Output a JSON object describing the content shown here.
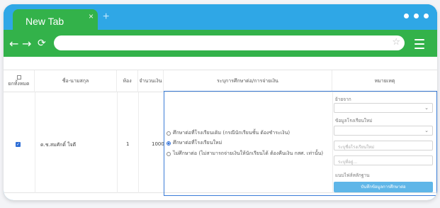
{
  "browser": {
    "tab_title": "New Tab",
    "tab_close": "×",
    "new_tab": "+",
    "back": "←",
    "forward": "→",
    "reload": "⟳",
    "url_value": "",
    "star": "☆"
  },
  "colors": {
    "tabbar": "#2fa7e6",
    "toolbar": "#33b24a",
    "accent": "#3b7dd8"
  },
  "table": {
    "headers": [
      "ยกทั้งหมด",
      "ชื่อ-นามสกุล",
      "ห้อง",
      "จำนวนเงิน",
      "ระบุการศึกษาต่อ/การจ่ายเงิน",
      "หมายเหตุ"
    ],
    "row": {
      "checked": "✓",
      "name": "ด.ช.สมศักดิ์ ใจดี",
      "room": "1",
      "amount": "1000",
      "options": [
        "ศึกษาต่อที่โรงเรียนเดิม (กรณีนักเรียนชั้น ต้องชำระเงิน)",
        "ศึกษาต่อที่โรงเรียนใหม่",
        "ไม่ศึกษาต่อ (ไม่สามารถจ่ายเงินให้นักเรียนได้ ต้องคืนเงิน กสศ. เท่านั้น)"
      ],
      "selected_option": 1,
      "remarks": {
        "label_1": "ย้ายจาก",
        "label_2": "ข้อมูลโรงเรียนใหม่",
        "placeholder_1": "ระบุชื่อโรงเรียนใหม่",
        "placeholder_2": "ระบุที่อยู่...",
        "label_3": "แนบไฟล์หลักฐาน",
        "submit_label": "บันทึกข้อมูลการศึกษาต่อ"
      }
    }
  }
}
